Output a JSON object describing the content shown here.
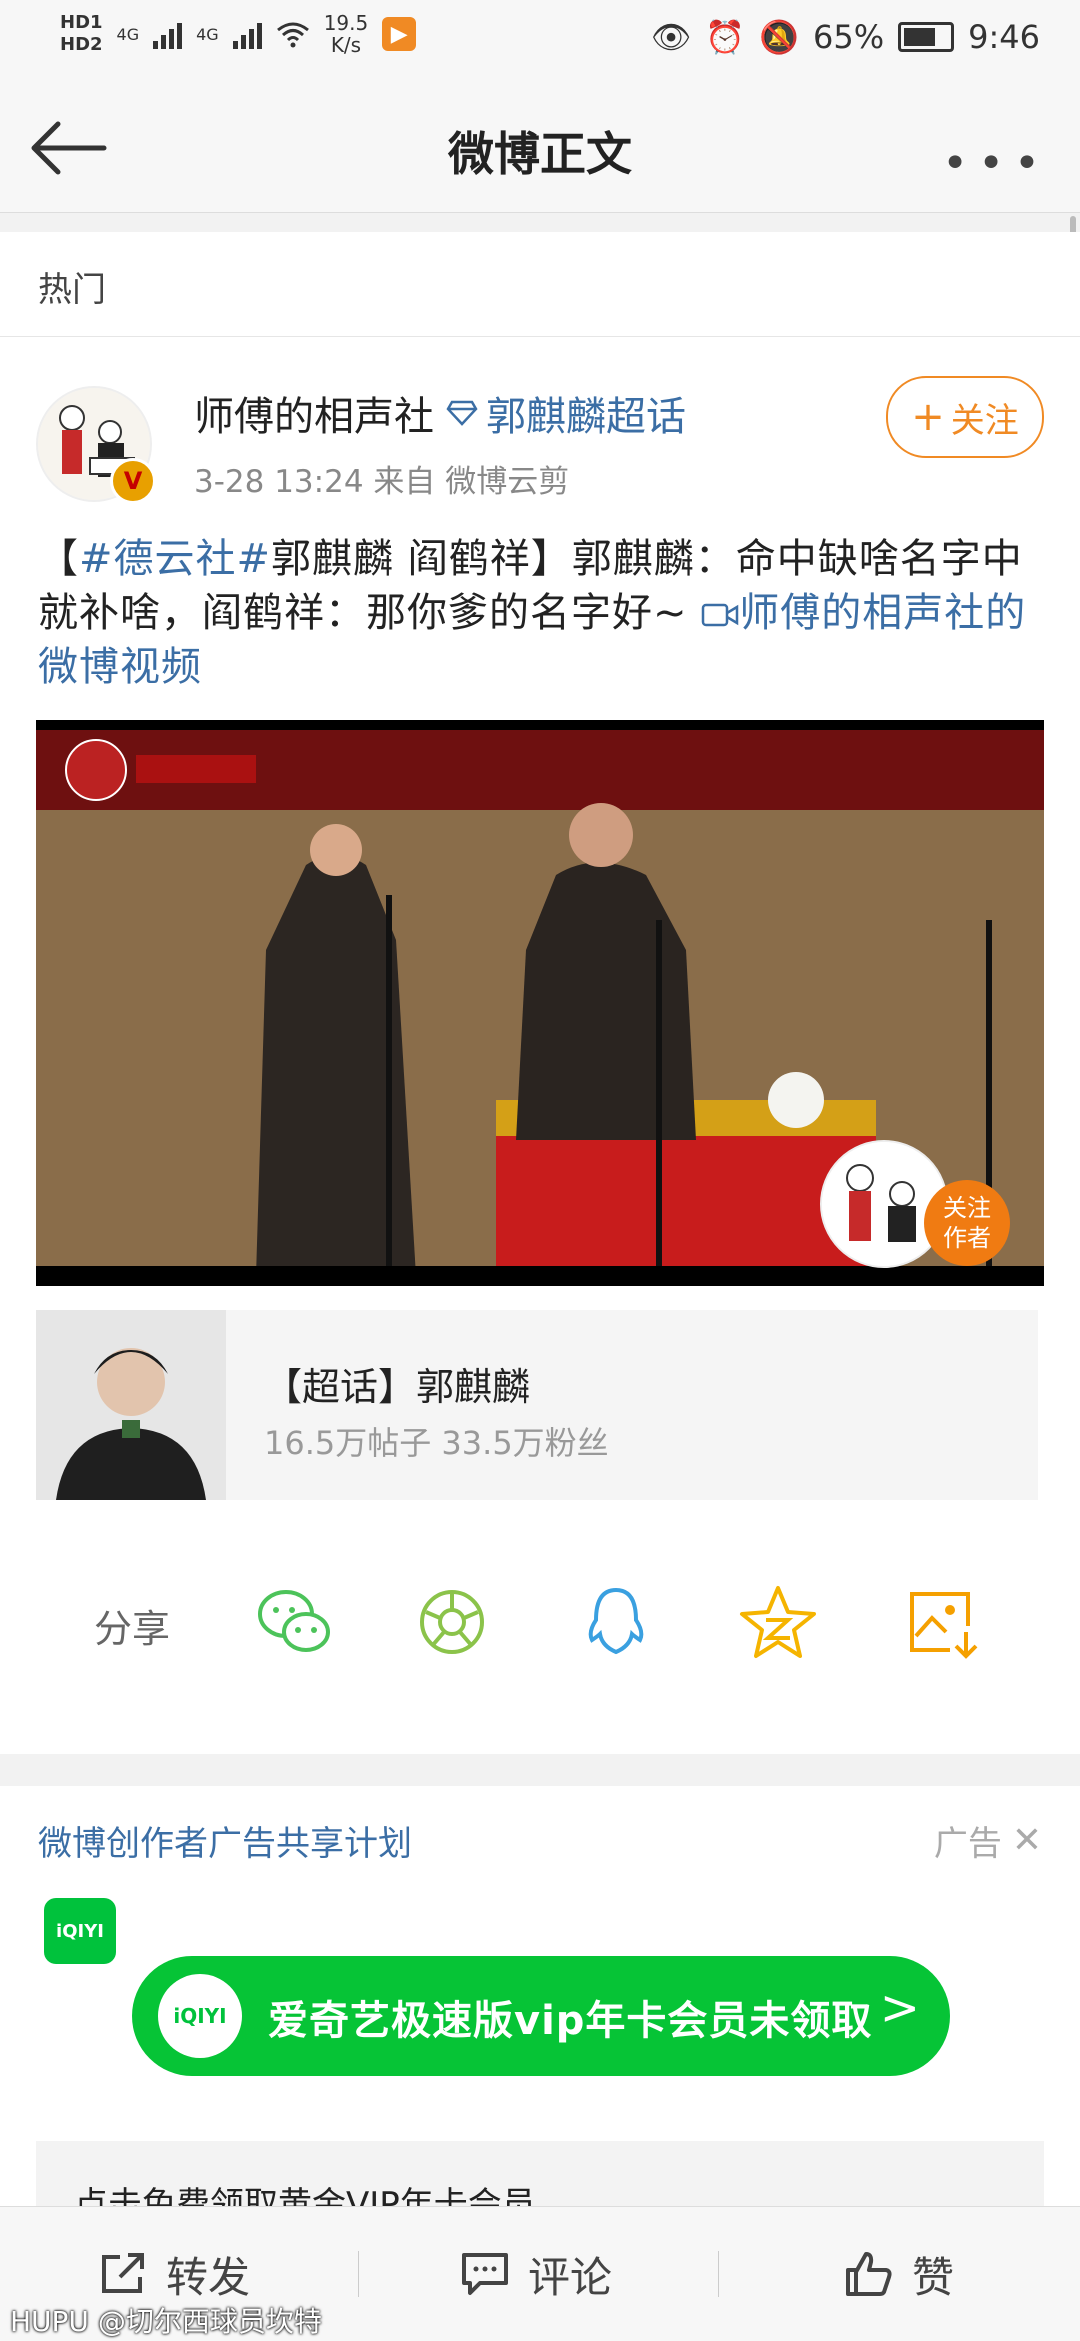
{
  "status_bar": {
    "hd1": "HD1",
    "hd2": "HD2",
    "signal1": "4G",
    "signal2": "4G",
    "net_speed_value": "19.5",
    "net_speed_unit": "K/s",
    "battery": "65%",
    "time": "9:46"
  },
  "nav": {
    "title": "微博正文",
    "more": "•••"
  },
  "post": {
    "section": "热门",
    "author": "师傅的相声社",
    "super_topic_link": "郭麒麟超话",
    "meta": "3-28 13:24  来自 微博云剪",
    "follow_label": "关注",
    "content_bracket_open": "【",
    "content_hashtag": "#德云社#",
    "content_body": "郭麒麟 阎鹤祥】郭麒麟：命中缺啥名字中就补啥，阎鹤祥：那你爹的名字好~ ",
    "content_video_link": "师傅的相声社的微博视频",
    "video_follow_author": "关注\n作者",
    "video_follow_line1": "关注",
    "video_follow_line2": "作者"
  },
  "super_topic_card": {
    "name": "【超话】郭麒麟",
    "stats": "16.5万帖子 33.5万粉丝"
  },
  "share": {
    "label": "分享",
    "icons": [
      "wechat-icon",
      "moments-icon",
      "qq-icon",
      "qzone-icon",
      "save-image-icon"
    ]
  },
  "ad": {
    "title": "微博创作者广告共享计划",
    "tag": "广告",
    "logo_text": "iQIYI",
    "banner_text": "爱奇艺极速版vip年卡会员未领取",
    "banner_arrow": ">",
    "sub_text": "点击免费领取黄金VIP年卡会员"
  },
  "bottom_bar": {
    "repost": "转发",
    "comment": "评论",
    "like": "赞"
  },
  "watermark": "HUPU @切尔西球员坎特",
  "colors": {
    "link_blue": "#3b6ea5",
    "follow_orange": "#f08a24",
    "wechat_green": "#4cc35a",
    "qq_blue": "#3aa0e0",
    "qzone_yellow": "#f5b400",
    "iqiyi_green": "#06c436"
  }
}
